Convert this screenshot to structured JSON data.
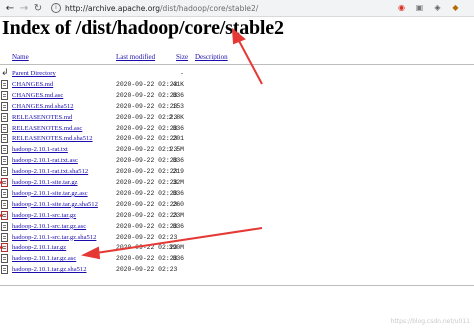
{
  "browser": {
    "url_host": "http://archive.apache.org",
    "url_path": "/dist/hadoop/core/stable2/"
  },
  "page": {
    "title": "Index of /dist/hadoop/core/stable2"
  },
  "columns": {
    "name": "Name",
    "modified": "Last modified",
    "size": "Size",
    "description": "Description"
  },
  "rows": [
    {
      "name": "Parent Directory",
      "date": "",
      "size": "-",
      "icon": "parent"
    },
    {
      "name": "CHANGES.md",
      "date": "2020-09-22 02:23",
      "size": "41K",
      "icon": "text"
    },
    {
      "name": "CHANGES.md.asc",
      "date": "2020-09-22 02:23",
      "size": "836",
      "icon": "text"
    },
    {
      "name": "CHANGES.md.sha512",
      "date": "2020-09-22 02:23",
      "size": "153",
      "icon": "text"
    },
    {
      "name": "RELEASENOTES.md",
      "date": "2020-09-22 02:23",
      "size": "2.8K",
      "icon": "text"
    },
    {
      "name": "RELEASENOTES.md.asc",
      "date": "2020-09-22 02:23",
      "size": "836",
      "icon": "text"
    },
    {
      "name": "RELEASENOTES.md.sha512",
      "date": "2020-09-22 02:23",
      "size": "201",
      "icon": "text"
    },
    {
      "name": "hadoop-2.10.1-rat.txt",
      "date": "2020-09-22 02:23",
      "size": "1.5M",
      "icon": "text"
    },
    {
      "name": "hadoop-2.10.1-rat.txt.asc",
      "date": "2020-09-22 02:23",
      "size": "836",
      "icon": "text"
    },
    {
      "name": "hadoop-2.10.1-rat.txt.sha512",
      "date": "2020-09-22 02:23",
      "size": "219",
      "icon": "text"
    },
    {
      "name": "hadoop-2.10.1-site.tar.gz",
      "date": "2020-09-22 02:23",
      "size": "32M",
      "icon": "compressed"
    },
    {
      "name": "hadoop-2.10.1-site.tar.gz.asc",
      "date": "2020-09-22 02:23",
      "size": "836",
      "icon": "text"
    },
    {
      "name": "hadoop-2.10.1-site.tar.gz.sha512",
      "date": "2020-09-22 02:23",
      "size": "260",
      "icon": "text"
    },
    {
      "name": "hadoop-2.10.1-src.tar.gz",
      "date": "2020-09-22 02:23",
      "size": "23M",
      "icon": "compressed"
    },
    {
      "name": "hadoop-2.10.1-src.tar.gz.asc",
      "date": "2020-09-22 02:23",
      "size": "836",
      "icon": "text"
    },
    {
      "name": "hadoop-2.10.1-src.tar.gz.sha512",
      "date": "2020-09-22 02:23",
      "size": "",
      "icon": "text"
    },
    {
      "name": "hadoop-2.10.1.tar.gz",
      "date": "2020-09-22 02:23",
      "size": "390M",
      "icon": "compressed"
    },
    {
      "name": "hadoop-2.10.1.tar.gz.asc",
      "date": "2020-09-22 02:23",
      "size": "836",
      "icon": "text"
    },
    {
      "name": "hadoop-2.10.1.tar.gz.sha512",
      "date": "2020-09-22 02:23",
      "size": "",
      "icon": "text"
    }
  ],
  "watermark": "https://blog.csdn.net/u011"
}
